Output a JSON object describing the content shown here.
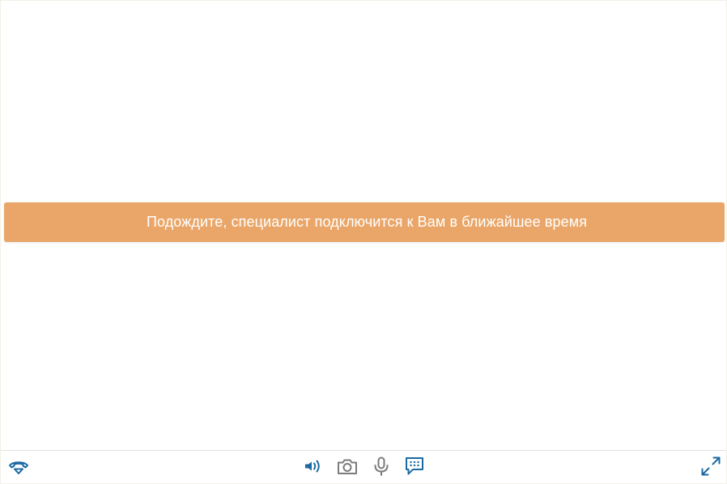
{
  "status": {
    "message": "Подождите, специалист подключится к Вам в ближайшее время",
    "color": "#eaa668"
  },
  "toolbar": {
    "accent_color": "#1a6aa1",
    "muted_color": "#7b7b7b",
    "buttons": [
      {
        "icon": "hangup-icon"
      },
      {
        "icon": "speaker-icon"
      },
      {
        "icon": "camera-icon"
      },
      {
        "icon": "microphone-icon"
      },
      {
        "icon": "chat-icon"
      },
      {
        "icon": "fullscreen-icon"
      }
    ]
  }
}
